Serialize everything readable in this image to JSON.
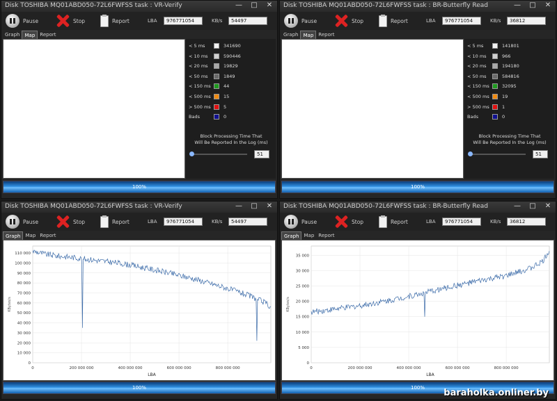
{
  "windows": [
    {
      "title": "Disk TOSHIBA MQ01ABD050-72L6FWFSS   task : VR-Verify",
      "toolbar": {
        "pause": "Pause",
        "stop": "Stop",
        "report": "Report",
        "lba_label": "LBA",
        "lba_value": "976771054",
        "kbs_label": "KB/s",
        "kbs_value": "54497"
      },
      "tabs": [
        "Graph",
        "Map",
        "Report"
      ],
      "active_tab": "Map",
      "legend": [
        {
          "label": "< 5 ms",
          "count": "341690",
          "color": "#f2f2f2"
        },
        {
          "label": "< 10 ms",
          "count": "590446",
          "color": "#d0d0d0"
        },
        {
          "label": "< 20 ms",
          "count": "19829",
          "color": "#a8a8a8"
        },
        {
          "label": "< 50 ms",
          "count": "1849",
          "color": "#6a6a6a"
        },
        {
          "label": "< 150 ms",
          "count": "44",
          "color": "#1f9a1f"
        },
        {
          "label": "< 500 ms",
          "count": "15",
          "color": "#f08a10"
        },
        {
          "label": "> 500 ms",
          "count": "5",
          "color": "#e01010"
        },
        {
          "label": "Bads",
          "count": "0",
          "color": "#101090"
        }
      ],
      "block_text_1": "Block Processing Time That",
      "block_text_2": "Will Be Reported In the Log (ms)",
      "slider_value": "51",
      "progress": "100%"
    },
    {
      "title": "Disk TOSHIBA MQ01ABD050-72L6FWFSS   task : BR-Butterfly Read",
      "toolbar": {
        "pause": "Pause",
        "stop": "Stop",
        "report": "Report",
        "lba_label": "LBA",
        "lba_value": "976771054",
        "kbs_label": "KB/s",
        "kbs_value": "36812"
      },
      "tabs": [
        "Graph",
        "Map",
        "Report"
      ],
      "active_tab": "Map",
      "legend": [
        {
          "label": "< 5 ms",
          "count": "141801",
          "color": "#f2f2f2"
        },
        {
          "label": "< 10 ms",
          "count": "966",
          "color": "#d0d0d0"
        },
        {
          "label": "< 20 ms",
          "count": "194180",
          "color": "#a8a8a8"
        },
        {
          "label": "< 50 ms",
          "count": "584816",
          "color": "#6a6a6a"
        },
        {
          "label": "< 150 ms",
          "count": "32095",
          "color": "#1f9a1f"
        },
        {
          "label": "< 500 ms",
          "count": "19",
          "color": "#f08a10"
        },
        {
          "label": "> 500 ms",
          "count": "1",
          "color": "#e01010"
        },
        {
          "label": "Bads",
          "count": "0",
          "color": "#101090"
        }
      ],
      "block_text_1": "Block Processing Time That",
      "block_text_2": "Will Be Reported In the Log (ms)",
      "slider_value": "51",
      "progress": "100%"
    },
    {
      "title": "Disk TOSHIBA MQ01ABD050-72L6FWFSS   task : VR-Verify",
      "toolbar": {
        "pause": "Pause",
        "stop": "Stop",
        "report": "Report",
        "lba_label": "LBA",
        "lba_value": "976771054",
        "kbs_label": "KB/s",
        "kbs_value": "54497"
      },
      "tabs": [
        "Graph",
        "Map",
        "Report"
      ],
      "active_tab": "Graph",
      "progress": "100%"
    },
    {
      "title": "Disk TOSHIBA MQ01ABD050-72L6FWFSS   task : BR-Butterfly Read",
      "toolbar": {
        "pause": "Pause",
        "stop": "Stop",
        "report": "Report",
        "lba_label": "LBA",
        "lba_value": "976771054",
        "kbs_label": "KB/s",
        "kbs_value": "36812"
      },
      "tabs": [
        "Graph",
        "Map",
        "Report"
      ],
      "active_tab": "Graph",
      "progress": "100%"
    }
  ],
  "chart_data": [
    {
      "type": "line",
      "xlabel": "LBA",
      "ylabel": "KBytes/s",
      "x_ticks": [
        "0",
        "200 000 000",
        "400 000 000",
        "600 000 000",
        "800 000 000"
      ],
      "y_ticks": [
        "0",
        "10 000",
        "20 000",
        "30 000",
        "40 000",
        "50 000",
        "60 000",
        "70 000",
        "80 000",
        "90 000",
        "100 000",
        "110 000"
      ],
      "xlim": [
        0,
        976771054
      ],
      "ylim": [
        0,
        117000
      ],
      "line_color": "#3a6aa8",
      "x": [
        0,
        50000000,
        100000000,
        150000000,
        200000000,
        250000000,
        300000000,
        350000000,
        400000000,
        450000000,
        500000000,
        550000000,
        600000000,
        650000000,
        700000000,
        750000000,
        800000000,
        850000000,
        900000000,
        950000000,
        976771054
      ],
      "values": [
        112000,
        109000,
        107000,
        106000,
        104500,
        103000,
        101500,
        100000,
        98000,
        95500,
        93000,
        90500,
        87500,
        85000,
        81500,
        78000,
        74500,
        70500,
        66000,
        60500,
        56000
      ],
      "dips": [
        {
          "x": 205000000,
          "y": 35000
        },
        {
          "x": 920000000,
          "y": 22000
        }
      ]
    },
    {
      "type": "line",
      "xlabel": "LBA",
      "ylabel": "KBytes/s",
      "x_ticks": [
        "0",
        "200 000 000",
        "400 000 000",
        "600 000 000",
        "800 000 000"
      ],
      "y_ticks": [
        "0",
        "5 000",
        "10 000",
        "15 000",
        "20 000",
        "25 000",
        "30 000",
        "35 000"
      ],
      "xlim": [
        0,
        976771054
      ],
      "ylim": [
        0,
        38000
      ],
      "line_color": "#3a6aa8",
      "x": [
        0,
        50000000,
        100000000,
        150000000,
        200000000,
        250000000,
        300000000,
        350000000,
        400000000,
        450000000,
        500000000,
        550000000,
        600000000,
        650000000,
        700000000,
        750000000,
        800000000,
        850000000,
        900000000,
        950000000,
        976771054
      ],
      "values": [
        16500,
        17000,
        17500,
        18000,
        18600,
        19300,
        20000,
        20800,
        21600,
        22500,
        23400,
        24300,
        25200,
        26000,
        26800,
        27500,
        28300,
        29500,
        30800,
        33000,
        36500
      ],
      "dips": [
        {
          "x": 465000000,
          "y": 15000
        }
      ]
    }
  ]
}
